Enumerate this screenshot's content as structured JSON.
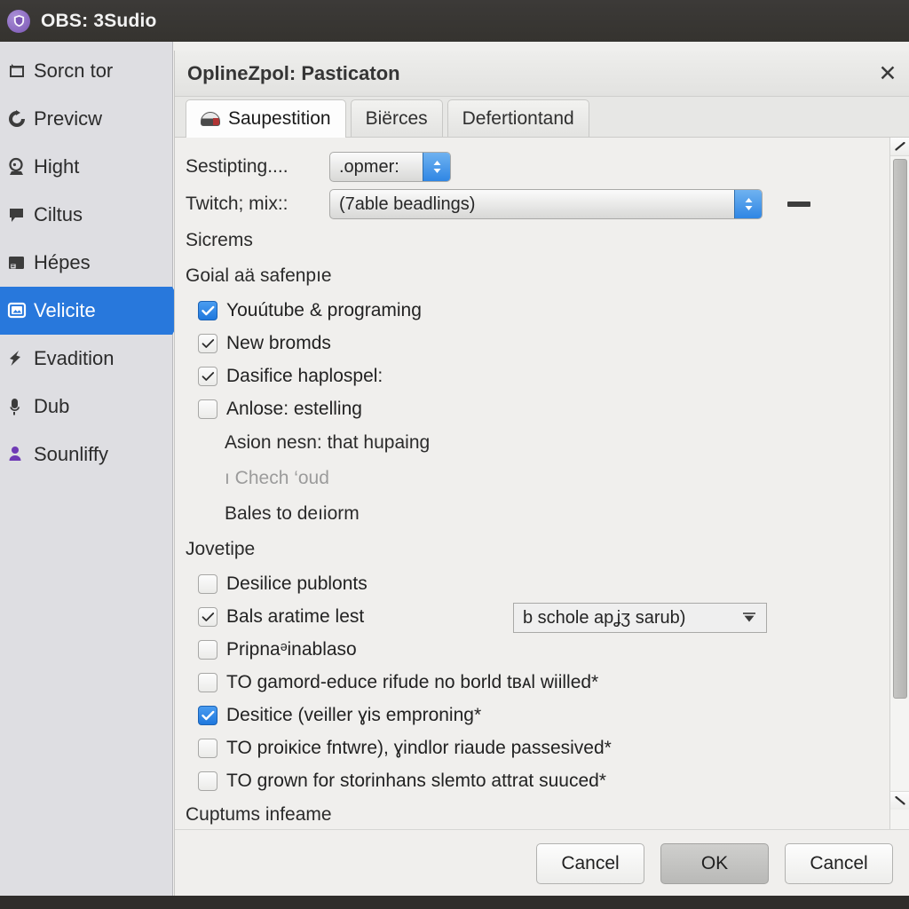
{
  "window": {
    "title": "OBS: 3Sudio",
    "icon": "shield-icon"
  },
  "sidebar": {
    "items": [
      {
        "label": "Sorcn tor",
        "icon": "screen-icon",
        "active": false,
        "accent": "dark"
      },
      {
        "label": "Previcw",
        "icon": "refresh-icon",
        "active": false,
        "accent": "dark"
      },
      {
        "label": "Hight",
        "icon": "webcam-icon",
        "active": false,
        "accent": "dark"
      },
      {
        "label": "Ciltus",
        "icon": "chat-icon",
        "active": false,
        "accent": "dark"
      },
      {
        "label": "Hépes",
        "icon": "window-icon",
        "active": false,
        "accent": "dark"
      },
      {
        "label": "Velicite",
        "icon": "display-icon",
        "active": true,
        "accent": "dark"
      },
      {
        "label": "Evadition",
        "icon": "upload-icon",
        "active": false,
        "accent": "dark"
      },
      {
        "label": "Dub",
        "icon": "mic-icon",
        "active": false,
        "accent": "dark"
      },
      {
        "label": "Sounliffy",
        "icon": "person-icon",
        "active": false,
        "accent": "purple"
      }
    ]
  },
  "dialog": {
    "title": "OplineZpol: Pasticaton",
    "close_label": "✕",
    "tabs": [
      {
        "label": "Saupestition",
        "icon": "mixer-icon",
        "active": true
      },
      {
        "label": "Biërces",
        "icon": "",
        "active": false
      },
      {
        "label": "Defertiontand",
        "icon": "",
        "active": false
      }
    ],
    "fields": {
      "setting_label": "Sestipting....",
      "setting_value": ".opmer:",
      "mix_label": "Twitch; mix::",
      "mix_value": "(7able beadlings)",
      "minus_label": "—"
    },
    "sections": {
      "screens_header": "Sicrems",
      "goal_header": "Goial aä safenpıe",
      "jovetipe_header": "Jovetipe",
      "captums_header": "Cuptums infeame"
    },
    "goal_checkboxes": [
      {
        "label": "Youútube & programing",
        "checked": true,
        "style": "blue"
      },
      {
        "label": "New bromds",
        "checked": true,
        "style": "plain"
      },
      {
        "label": "Dasifice haplospel:",
        "checked": true,
        "style": "plain"
      },
      {
        "label": "Anlose: estelling",
        "checked": false,
        "style": "plain"
      }
    ],
    "sub_texts": {
      "asion": "Asion nesn: that hupaing",
      "chech": "ı Chech ‘oud",
      "bales": "Bales to deıiorm"
    },
    "popup_select": {
      "value": "b schole apʝʒ sarub)",
      "arrow": "▼"
    },
    "jovetipe_checkboxes": [
      {
        "label": "Desilice publonts",
        "checked": false,
        "style": "plain"
      },
      {
        "label": "Bals aratime lest",
        "checked": true,
        "style": "plain"
      },
      {
        "label": "Pripnaᵊinablaso",
        "checked": false,
        "style": "plain"
      },
      {
        "label": "TO gamord-educe rifude no borld tʙᴀl wiilled*",
        "checked": false,
        "style": "plain"
      },
      {
        "label": "Desitice (veiller ɣis emproning*",
        "checked": true,
        "style": "blue"
      },
      {
        "label": "TO proiᴋice fntᴡre), ɣindlor riaude passesived*",
        "checked": false,
        "style": "plain"
      },
      {
        "label": "TO grown for storinhanѕ slemto attrat suuced*",
        "checked": false,
        "style": "plain"
      }
    ],
    "buttons": [
      {
        "label": "Cancel",
        "state": "normal"
      },
      {
        "label": "OK",
        "state": "pressed"
      },
      {
        "label": "Cancel",
        "state": "normal"
      }
    ],
    "scrollbar": {
      "up_arrow": "▲",
      "down_arrow": "▼"
    }
  },
  "colors": {
    "accent_blue": "#2878dc",
    "titlebar": "#3a3835",
    "sidebar": "#dedee2",
    "purple": "#6f3ab5"
  }
}
